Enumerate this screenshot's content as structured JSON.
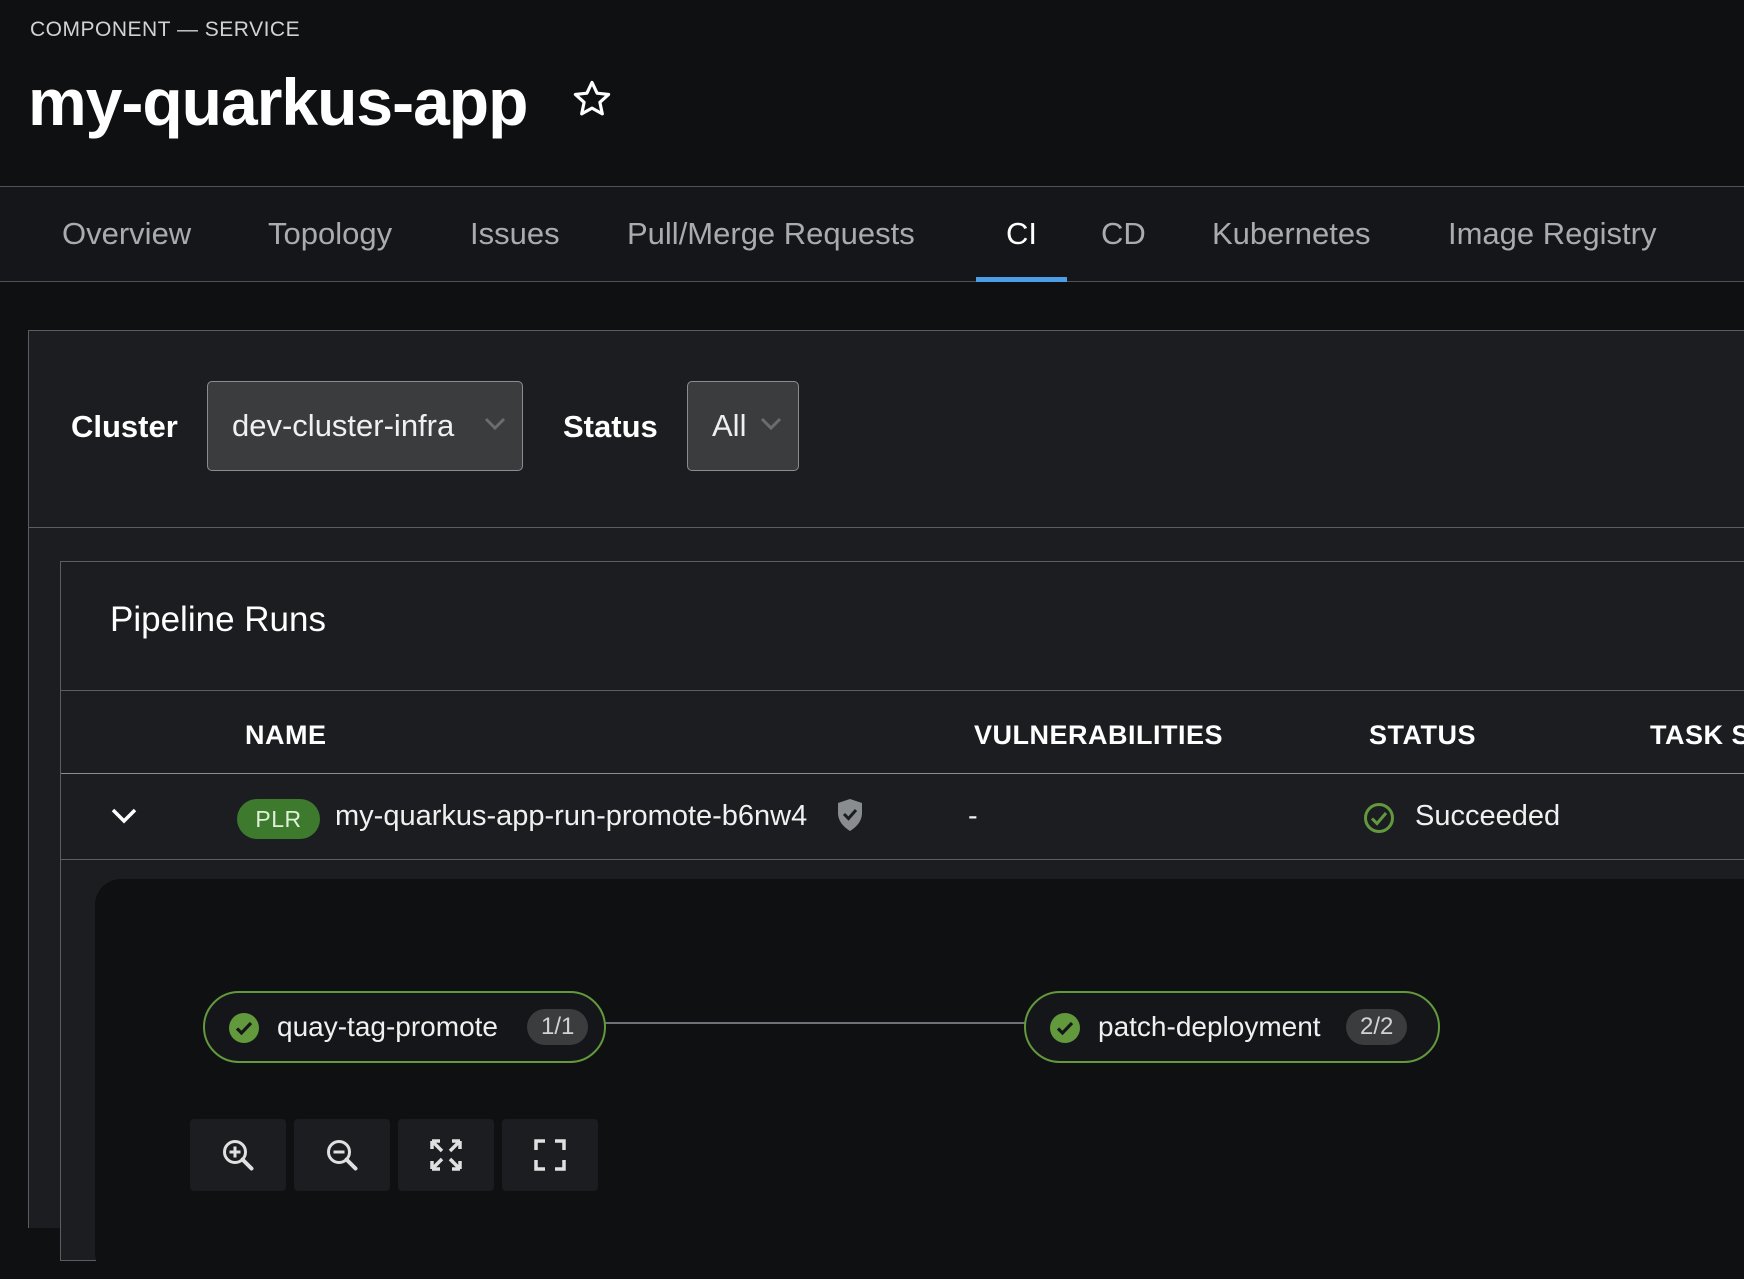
{
  "header": {
    "kind": "COMPONENT — SERVICE",
    "title": "my-quarkus-app"
  },
  "tabs": [
    {
      "label": "Overview",
      "active": false
    },
    {
      "label": "Topology",
      "active": false
    },
    {
      "label": "Issues",
      "active": false
    },
    {
      "label": "Pull/Merge Requests",
      "active": false
    },
    {
      "label": "CI",
      "active": true
    },
    {
      "label": "CD",
      "active": false
    },
    {
      "label": "Kubernetes",
      "active": false
    },
    {
      "label": "Image Registry",
      "active": false
    }
  ],
  "filters": {
    "cluster_label": "Cluster",
    "cluster_value": "dev-cluster-infra",
    "status_label": "Status",
    "status_value": "All"
  },
  "pipeline_runs": {
    "title": "Pipeline Runs",
    "columns": [
      "NAME",
      "VULNERABILITIES",
      "STATUS",
      "TASK S"
    ],
    "rows": [
      {
        "badge": "PLR",
        "name": "my-quarkus-app-run-promote-b6nw4",
        "vulnerabilities": "-",
        "status": "Succeeded"
      }
    ]
  },
  "graph": {
    "nodes": [
      {
        "name": "quay-tag-promote",
        "count": "1/1"
      },
      {
        "name": "patch-deployment",
        "count": "2/2"
      }
    ],
    "controls": [
      "zoom-in-icon",
      "zoom-out-icon",
      "fit-to-screen-icon",
      "fullscreen-icon"
    ]
  },
  "colors": {
    "accent": "#4c9fe6",
    "success": "#63993d",
    "badge": "#3e7a2e"
  }
}
